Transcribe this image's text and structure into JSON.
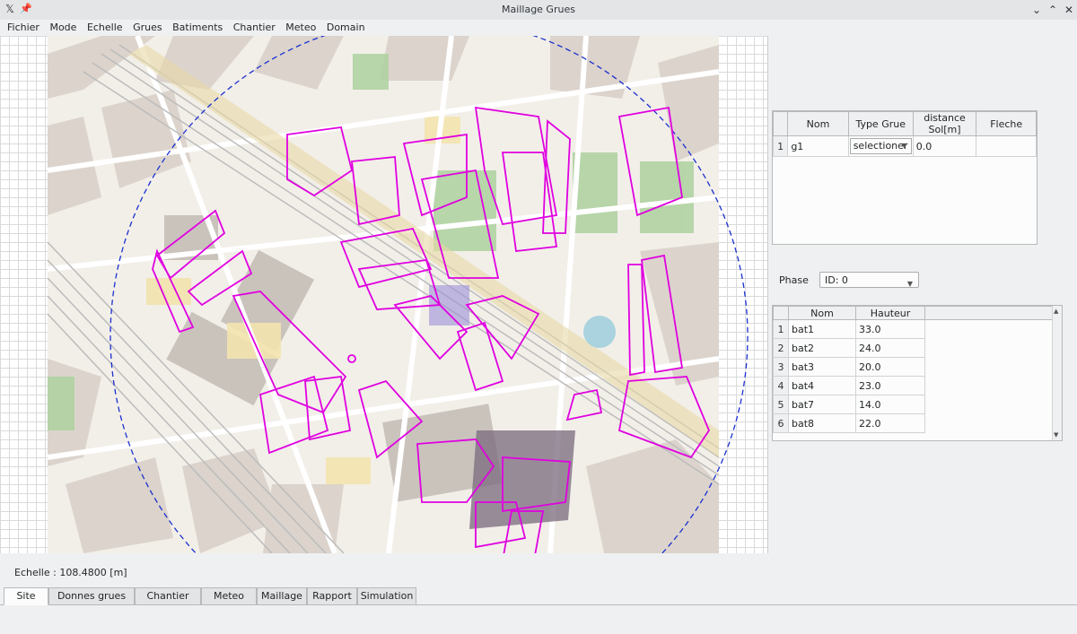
{
  "window": {
    "title": "Maillage Grues",
    "pin_icon": "pin-icon",
    "app_icon": "x-app-icon",
    "buttons": [
      "chevron-down-icon",
      "chevron-up-icon",
      "close-icon"
    ]
  },
  "menu": [
    "Fichier",
    "Mode",
    "Echelle",
    "Grues",
    "Batiments",
    "Chantier",
    "Meteo",
    "Domain"
  ],
  "grues_table": {
    "headers": [
      "Nom",
      "Type Grue",
      "distance Sol[m]",
      "Fleche"
    ],
    "rows": [
      {
        "num": "1",
        "nom": "g1",
        "type": "selectioner",
        "distance": "0.0",
        "fleche": ""
      }
    ]
  },
  "phase": {
    "label": "Phase",
    "value": "ID: 0"
  },
  "batiments_table": {
    "headers": [
      "Nom",
      "Hauteur"
    ],
    "rows": [
      {
        "num": "1",
        "nom": "bat1",
        "hauteur": "33.0"
      },
      {
        "num": "2",
        "nom": "bat2",
        "hauteur": "24.0"
      },
      {
        "num": "3",
        "nom": "bat3",
        "hauteur": "20.0"
      },
      {
        "num": "4",
        "nom": "bat4",
        "hauteur": "23.0"
      },
      {
        "num": "5",
        "nom": "bat7",
        "hauteur": "14.0"
      },
      {
        "num": "6",
        "nom": "bat8",
        "hauteur": "22.0"
      }
    ]
  },
  "scale_text": "Echelle : 108.4800 [m]",
  "tabs": [
    "Site",
    "Donnes grues",
    "Chantier",
    "Meteo",
    "Maillage",
    "Rapport",
    "Simulation"
  ],
  "active_tab": "Site",
  "colors": {
    "building_outline": "#e000e0",
    "crane_radius": "#1a2fcf",
    "map_background": "#f2efe9",
    "rail": "#e8d9a6"
  }
}
